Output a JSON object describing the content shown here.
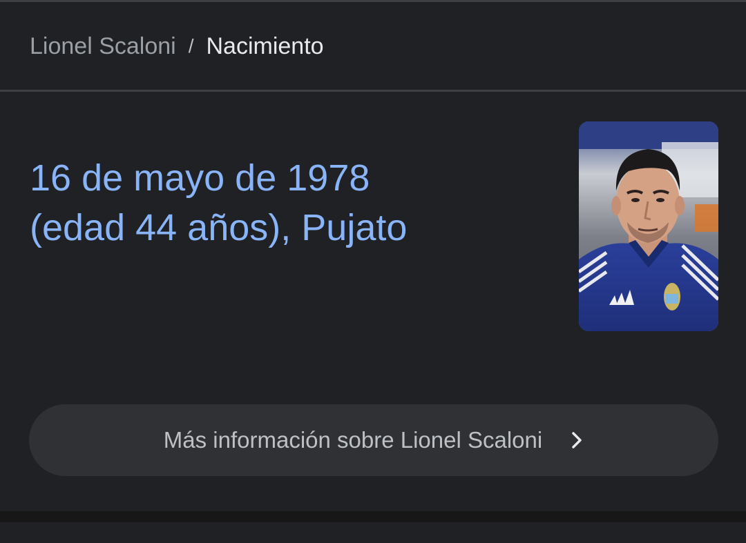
{
  "breadcrumb": {
    "parent": "Lionel Scaloni",
    "separator": "/",
    "current": "Nacimiento"
  },
  "answer": {
    "line1": "16 de mayo de 1978",
    "line2": "(edad 44 años), Pujato"
  },
  "photo": {
    "alt": "Lionel Scaloni"
  },
  "more_button": {
    "label": "Más información sobre Lionel Scaloni",
    "icon": "chevron-right-icon"
  },
  "colors": {
    "background": "#202124",
    "answer_text": "#8ab4f8",
    "button_background": "#303134",
    "divider": "#3c4043"
  }
}
